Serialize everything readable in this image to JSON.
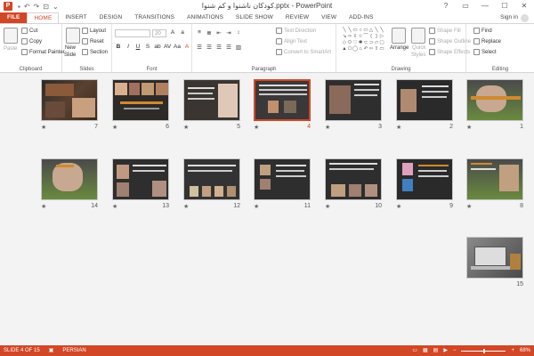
{
  "window": {
    "title": "کودکان ناشنوا و کم شنوا.pptx - PowerPoint",
    "controls": [
      "?",
      "▭",
      "—",
      "☐",
      "✕"
    ]
  },
  "tabs": [
    "FILE",
    "HOME",
    "INSERT",
    "DESIGN",
    "TRANSITIONS",
    "ANIMATIONS",
    "SLIDE SHOW",
    "REVIEW",
    "VIEW",
    "ADD-INS"
  ],
  "signin": "Sign in",
  "ribbon": {
    "clipboard": {
      "label": "Clipboard",
      "paste": "Paste",
      "cut": "Cut",
      "copy": "Copy",
      "format_painter": "Format Painter"
    },
    "slides": {
      "label": "Slides",
      "new_slide": "New",
      "new_slide2": "Slide",
      "layout": "Layout",
      "reset": "Reset",
      "section": "Section"
    },
    "font": {
      "label": "Font",
      "size": "20"
    },
    "paragraph": {
      "label": "Paragraph",
      "text_direction": "Text Direction",
      "align_text": "Align Text",
      "convert": "Convert to SmartArt"
    },
    "drawing": {
      "label": "Drawing",
      "arrange": "Arrange",
      "quick_styles": "Quick",
      "quick_styles2": "Styles",
      "shape_fill": "Shape Fill",
      "shape_outline": "Shape Outline",
      "shape_effects": "Shape Effects"
    },
    "editing": {
      "label": "Editing",
      "find": "Find",
      "replace": "Replace",
      "select": "Select"
    }
  },
  "slides": [
    {
      "n": "7"
    },
    {
      "n": "6"
    },
    {
      "n": "5"
    },
    {
      "n": "4"
    },
    {
      "n": "3"
    },
    {
      "n": "2"
    },
    {
      "n": "1"
    },
    {
      "n": "14"
    },
    {
      "n": "13"
    },
    {
      "n": "12"
    },
    {
      "n": "11"
    },
    {
      "n": "10"
    },
    {
      "n": "9"
    },
    {
      "n": "8"
    },
    {
      "n": "15"
    }
  ],
  "selected_slide": "4",
  "status": {
    "slide": "SLIDE 4 OF 15",
    "language": "PERSIAN",
    "zoom": "68%"
  },
  "colors": {
    "accent": "#d24726"
  }
}
